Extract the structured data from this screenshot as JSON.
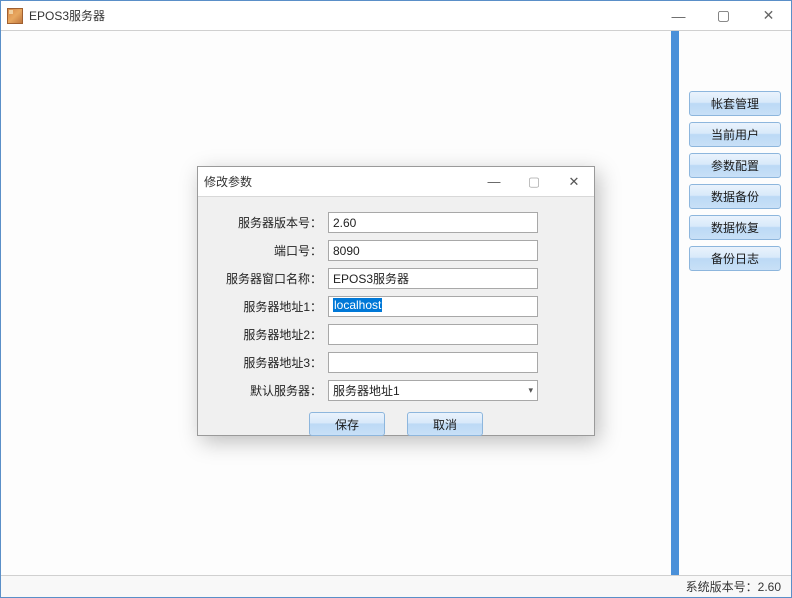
{
  "window": {
    "title": "EPOS3服务器"
  },
  "sidebar": {
    "buttons": [
      "帐套管理",
      "当前用户",
      "参数配置",
      "数据备份",
      "数据恢复",
      "备份日志"
    ]
  },
  "status": {
    "label": "系统版本号：",
    "value": "2.60"
  },
  "dialog": {
    "title": "修改参数",
    "fields": {
      "version": {
        "label": "服务器版本号：",
        "value": "2.60"
      },
      "port": {
        "label": "端口号：",
        "value": "8090"
      },
      "wname": {
        "label": "服务器窗口名称：",
        "value": "EPOS3服务器"
      },
      "addr1": {
        "label": "服务器地址1：",
        "value": "localhost"
      },
      "addr2": {
        "label": "服务器地址2：",
        "value": ""
      },
      "addr3": {
        "label": "服务器地址3：",
        "value": ""
      },
      "default": {
        "label": "默认服务器：",
        "value": "服务器地址1"
      }
    },
    "buttons": {
      "save": "保存",
      "cancel": "取消"
    }
  }
}
